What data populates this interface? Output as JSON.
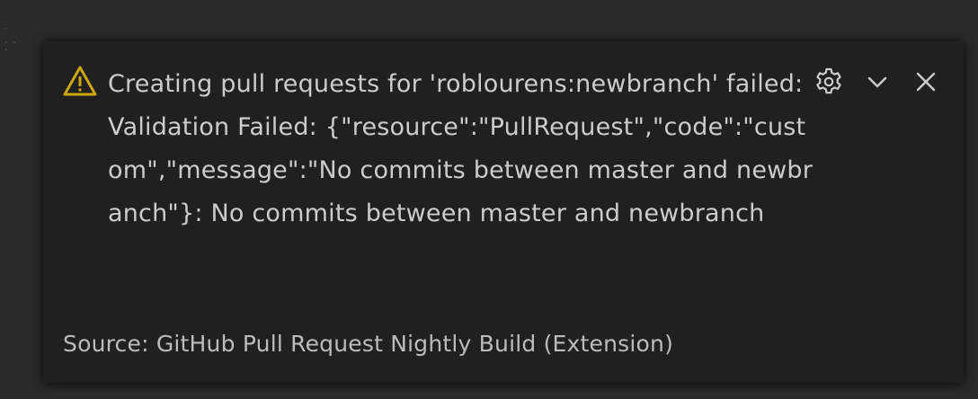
{
  "notification": {
    "severity_icon": "warning-icon",
    "message": "Creating pull requests for 'roblourens:newbranch' failed: Validation Failed: {\"resource\":\"PullRequest\",\"code\":\"custom\",\"message\":\"No commits between master and newbranch\"}: No commits between master and newbranch",
    "source": "Source: GitHub Pull Request Nightly Build (Extension)",
    "actions": [
      {
        "name": "configure",
        "icon": "gear-icon"
      },
      {
        "name": "collapse",
        "icon": "chevron-down-icon"
      },
      {
        "name": "close",
        "icon": "close-icon"
      }
    ]
  },
  "colors": {
    "background": "#2b2b28",
    "toast_background": "#202020",
    "text": "#cccccc",
    "warning": "#cca700"
  }
}
